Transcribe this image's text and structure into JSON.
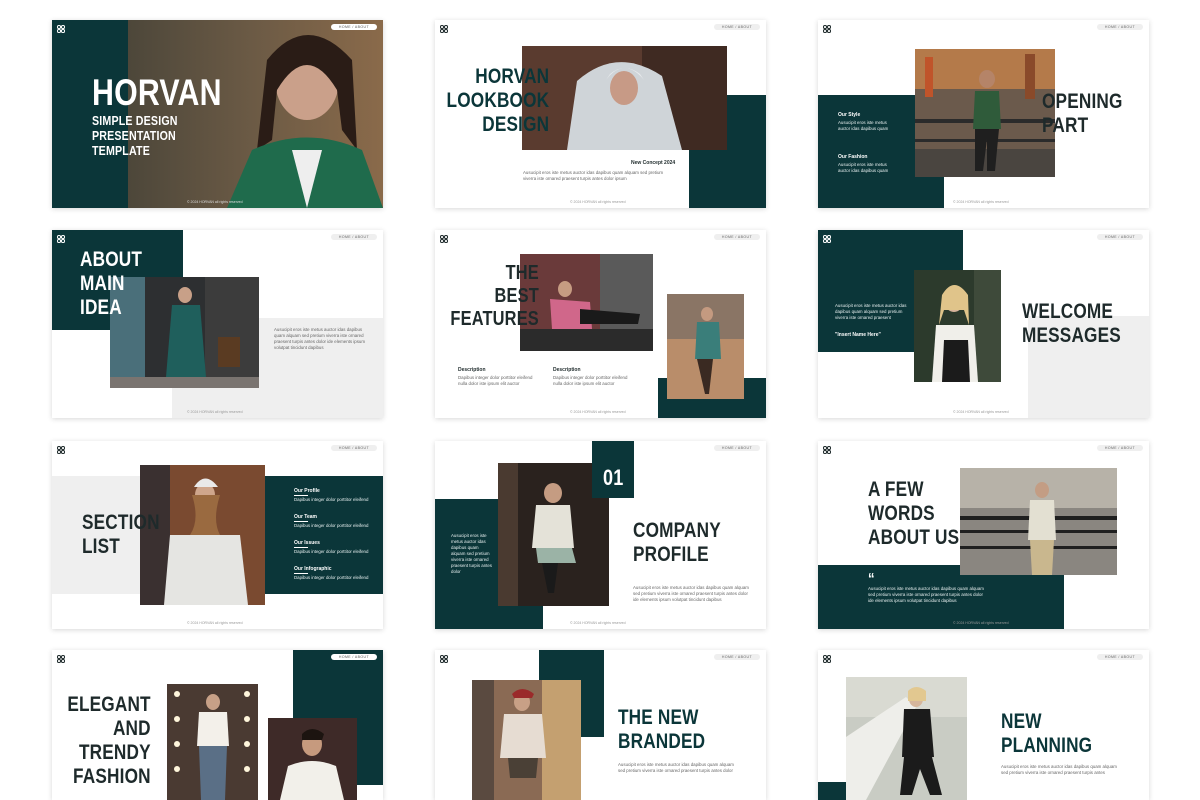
{
  "colors": {
    "accent": "#0b3639",
    "grey_panel": "#efefef",
    "text_dark": "#1e2a2b"
  },
  "common": {
    "nav": "HOME / ABOUT",
    "footer": "© 2024 HORVAN  all rights reserved",
    "lorem_long": "Ausucipit eros iste metus auctor idas dapibus quam alquam sed pretium viverra iste ornared praesent turpis antes dolor ide elements ipsum volutpat tincidunt dapibus",
    "lorem_short": "Dapibus integer dolor porttitor eleifend"
  },
  "slides": {
    "s1": {
      "title": "HORVAN",
      "subtitle": "SIMPLE DESIGN\nPRESENTATION\nTEMPLATE"
    },
    "s2": {
      "title": "HORVAN\nLOOKBOOK\nDESIGN",
      "heading": "New Concept 2024",
      "body": "Ausucipit eros iste metus auctor idas dapibus quam alquam sed pretium viverra iste ornared praesent turpis antes dolor ipsum"
    },
    "s3": {
      "title": "OPENING\nPART",
      "label1": "Our Style",
      "body1": "Ausucipit eros iste metus auctor idas dapibus quam",
      "label2": "Our Fashion",
      "body2": "Ausucipit eros iste metus auctor idas dapibus quam"
    },
    "s4": {
      "title": "ABOUT\nMAIN\nIDEA",
      "body": "Ausucipit eros iste metus auctor idas dapibus quam alquam sed pretium viverra iste ornared praesent turpis antes dolor ide elements ipsum volutpat tincidunt dapibus"
    },
    "s5": {
      "title": "THE\nBEST\nFEATURES",
      "label1": "Description",
      "label2": "Description",
      "body1": "Dapibus integer dolor porttitor eleifend nulla dolor iste ipsum elit auctor",
      "body2": "Dapibus integer dolor porttitor eleifend nulla dolor iste ipsum elit auctor"
    },
    "s6": {
      "title": "WELCOME\nMESSAGES",
      "body": "Ausucipit eros iste metus auctor idas dapibus quam alquam sed pretium viverra iste ornared praesent",
      "quote_name": "\"Insert Name Here\""
    },
    "s7": {
      "title": "SECTION\nLIST",
      "items": [
        {
          "label": "Our Profile",
          "body": "Dapibus integer dolor porttitor eleifend"
        },
        {
          "label": "Our Team",
          "body": "Dapibus integer dolor porttitor eleifend"
        },
        {
          "label": "Our Issues",
          "body": "Dapibus integer dolor porttitor eleifend"
        },
        {
          "label": "Our Infographic",
          "body": "Dapibus integer dolor porttitor eleifend"
        }
      ]
    },
    "s8": {
      "number": "01",
      "title": "COMPANY\nPROFILE",
      "side": "Ausucipit eros iste metus auctor idas dapibus quam alquam sed pretium viverra iste ornared praesent turpis antes dolor",
      "body": "Ausucipit eros iste metus auctor idas dapibus quam alquam sed pretium viverra iste ornared praesent turpis antes dolor ide elements ipsum volutpat tincidunt dapibus"
    },
    "s9": {
      "title": "A FEW\nWORDS\nABOUT US",
      "quote_mark": "“",
      "body": "Ausucipit eros iste metus auctor idas dapibus quam alquam sed pretium viverra iste ornared praesent turpis antes dolor ide elements ipsum volutpat tincidunt dapibus"
    },
    "s10": {
      "title": "ELEGANT\nAND\nTRENDY\nFASHION"
    },
    "s11": {
      "title": "THE NEW\nBRANDED",
      "body": "Ausucipit eros iste metus auctor idas dapibus quam alquam sed pretium viverra iste ornared praesent turpis antes dolor"
    },
    "s12": {
      "title": "NEW\nPLANNING",
      "body": "Ausucipit eros iste metus auctor idas dapibus quam alquam sed pretium viverra iste ornared praesent turpis antes"
    }
  }
}
